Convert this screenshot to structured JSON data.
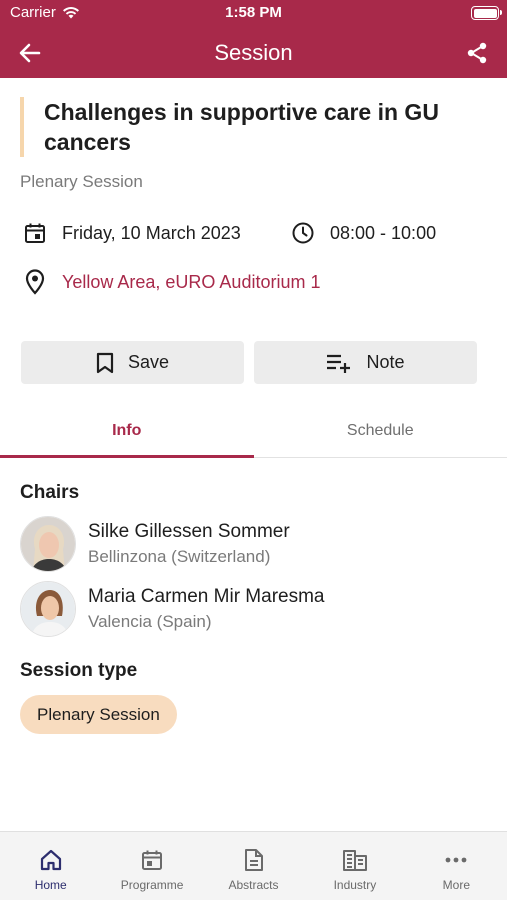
{
  "status_bar": {
    "carrier": "Carrier",
    "time": "1:58 PM"
  },
  "nav": {
    "title": "Session",
    "back_icon": "arrow-left-icon",
    "share_icon": "share-icon"
  },
  "session": {
    "title": "Challenges in supportive care in GU cancers",
    "subtitle": "Plenary Session",
    "date": "Friday, 10 March 2023",
    "time": "08:00 - 10:00",
    "location": "Yellow Area, eURO Auditorium 1"
  },
  "actions": {
    "save_label": "Save",
    "note_label": "Note"
  },
  "tabs": [
    {
      "label": "Info",
      "active": true
    },
    {
      "label": "Schedule",
      "active": false
    }
  ],
  "chairs": {
    "heading": "Chairs",
    "people": [
      {
        "name": "Silke Gillessen Sommer",
        "location": "Bellinzona (Switzerland)"
      },
      {
        "name": "Maria Carmen Mir Maresma",
        "location": "Valencia (Spain)"
      }
    ]
  },
  "session_type": {
    "heading": "Session type",
    "value": "Plenary Session"
  },
  "tabbar": [
    {
      "label": "Home",
      "icon": "home-icon",
      "active": true
    },
    {
      "label": "Programme",
      "icon": "calendar-icon",
      "active": false
    },
    {
      "label": "Abstracts",
      "icon": "document-icon",
      "active": false
    },
    {
      "label": "Industry",
      "icon": "building-icon",
      "active": false
    },
    {
      "label": "More",
      "icon": "more-icon",
      "active": false
    }
  ],
  "colors": {
    "brand": "#a8294a",
    "accent_pill": "#f8dcbf",
    "tab_active": "#2d2e6e"
  }
}
